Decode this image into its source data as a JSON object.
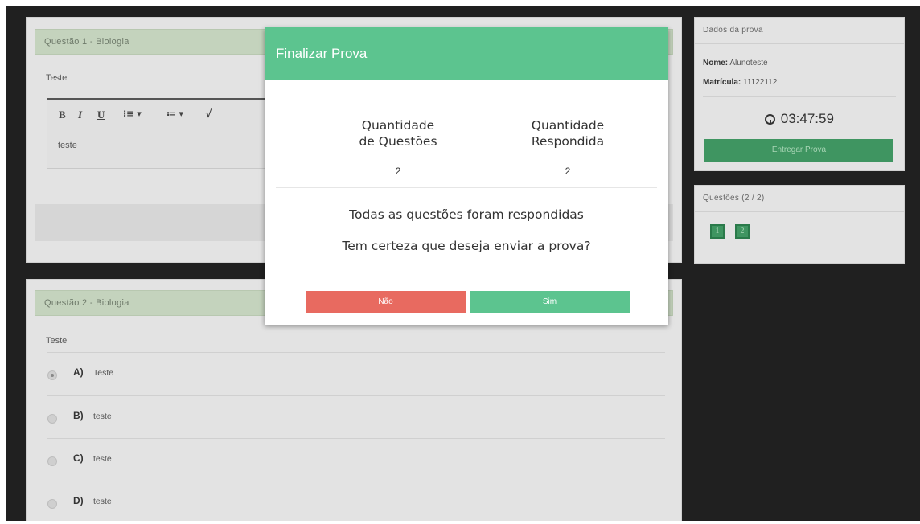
{
  "questions": [
    {
      "header": "Questão 1 - Biologia",
      "prompt": "Teste",
      "answer_text": "teste",
      "toolbar": {
        "bold": "B",
        "italic": "I",
        "underline": "U",
        "ordered_list": "⁝≡ ▾",
        "bullet_list": "≔ ▾",
        "math": "√"
      }
    },
    {
      "header": "Questão 2 - Biologia",
      "prompt": "Teste",
      "options": [
        {
          "letter": "A)",
          "text": "Teste",
          "selected": true
        },
        {
          "letter": "B)",
          "text": "teste",
          "selected": false
        },
        {
          "letter": "C)",
          "text": "teste",
          "selected": false
        },
        {
          "letter": "D)",
          "text": "teste",
          "selected": false
        }
      ]
    }
  ],
  "exam_info": {
    "header": "Dados da prova",
    "name_label": "Nome:",
    "name_value": "Alunoteste",
    "id_label": "Matrícula:",
    "id_value": "11122112",
    "timer": "03:47:59",
    "submit_label": "Entregar Prova"
  },
  "question_nav": {
    "header": "Questões (2 / 2)",
    "buttons": [
      "1",
      "2"
    ]
  },
  "modal": {
    "title": "Finalizar Prova",
    "col1_line1": "Quantidade",
    "col1_line2": "de Questões",
    "col1_value": "2",
    "col2_line1": "Quantidade",
    "col2_line2": "Respondida",
    "col2_value": "2",
    "message1": "Todas as questões foram respondidas",
    "message2": "Tem certeza que deseja enviar a prova?",
    "no_label": "Não",
    "yes_label": "Sim"
  },
  "colors": {
    "header_green": "#5cc48f",
    "no_red": "#e86a60",
    "yes_green": "#5cc48f",
    "dark_green": "#3f9561"
  }
}
